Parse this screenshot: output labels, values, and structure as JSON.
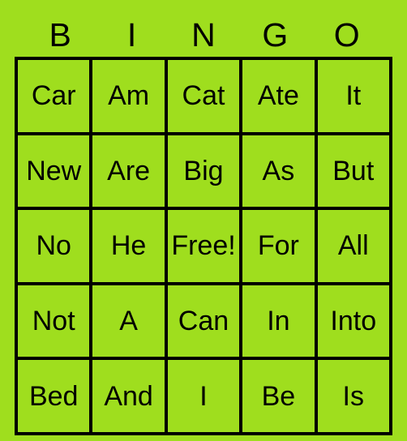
{
  "card": {
    "title": "BINGO",
    "background_color": "#9FDE1E",
    "text_color": "#000000",
    "border_color": "#000000",
    "header_letters": [
      "B",
      "I",
      "N",
      "G",
      "O"
    ],
    "grid_size": "5x5",
    "free_space": "Free!",
    "rows": [
      [
        "Car",
        "Am",
        "Cat",
        "Ate",
        "It"
      ],
      [
        "New",
        "Are",
        "Big",
        "As",
        "But"
      ],
      [
        "No",
        "He",
        "Free!",
        "For",
        "All"
      ],
      [
        "Not",
        "A",
        "Can",
        "In",
        "Into"
      ],
      [
        "Bed",
        "And",
        "I",
        "Be",
        "Is"
      ]
    ]
  }
}
